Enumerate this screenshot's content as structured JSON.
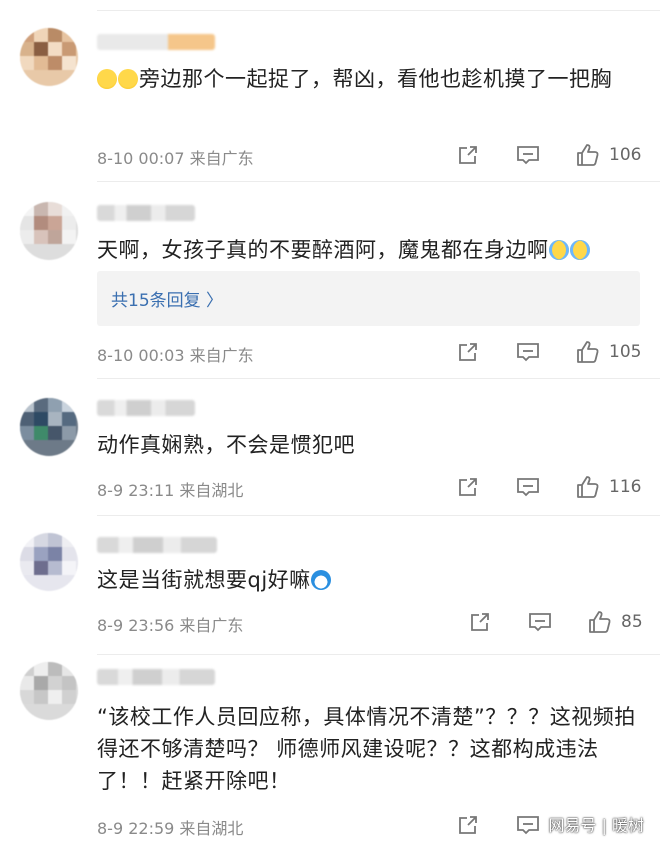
{
  "comments": [
    {
      "id": "c1",
      "emoji_prefix": [
        "grinning-sweat-emoji",
        "grinning-sweat-emoji"
      ],
      "text": "旁边那个一起捉了，帮凶，看他也趁机摸了一把胸",
      "time": "8-10 00:07",
      "location": "来自广东",
      "likes": "106"
    },
    {
      "id": "c2",
      "text": "天啊，女孩子真的不要醉酒阿，魔鬼都在身边啊",
      "emoji_suffix": [
        "crying-emoji",
        "crying-emoji"
      ],
      "reply_link": "共15条回复 〉",
      "time": "8-10 00:03",
      "location": "来自广东",
      "likes": "105"
    },
    {
      "id": "c3",
      "text": "动作真娴熟，不会是惯犯吧",
      "time": "8-9 23:11",
      "location": "来自湖北",
      "likes": "116"
    },
    {
      "id": "c4",
      "text": "这是当街就想要qj好嘛",
      "emoji_suffix": [
        "doraemon-emoji"
      ],
      "time": "8-9 23:56",
      "location": "来自广东",
      "likes": "85"
    },
    {
      "id": "c5",
      "text": "“该校工作人员回应称，具体情况不清楚”？？？这视频拍得还不够清楚吗？ 师德师风建设呢？？这都构成违法了！！赶紧开除吧！",
      "time": "8-9 22:59",
      "location": "来自湖北",
      "likes": ""
    }
  ],
  "watermark": "网易号 | 暖树",
  "colors": {
    "link": "#3a6fb0",
    "meta": "#8a8a8a",
    "divider": "#ececec",
    "reply_bg": "#f3f3f3"
  }
}
